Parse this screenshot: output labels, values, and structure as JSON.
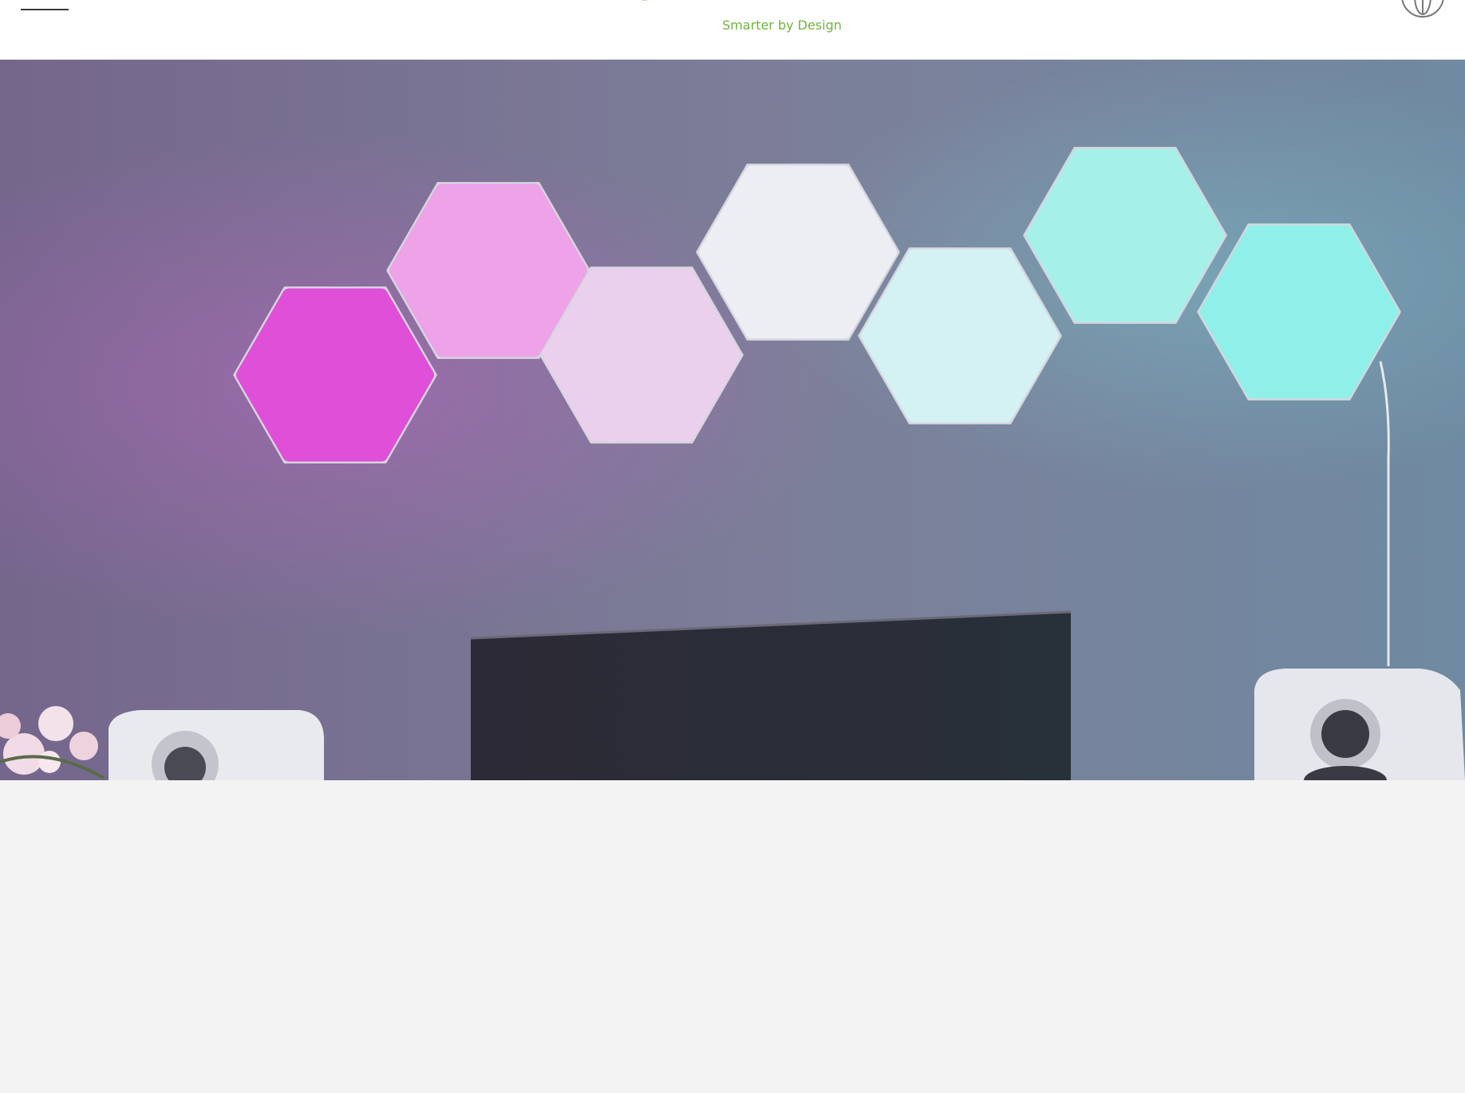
{
  "header": {
    "brand": "nanoleaf",
    "tagline": "Smarter by Design"
  },
  "icons": {
    "menu": "hamburger-menu-icon",
    "logo": "nanoleaf-logo-icon",
    "globe": "globe-icon"
  },
  "hero": {
    "panel_colors": [
      "#e04fd8",
      "#eea2e8",
      "#ebd0ee",
      "#eceef4",
      "#d4f1f3",
      "#a6f0ea",
      "#8ff0ea"
    ],
    "wall_color": "#7d7f99"
  },
  "colors": {
    "accent": "#6db33f",
    "page_bg": "#f3f3f3"
  }
}
